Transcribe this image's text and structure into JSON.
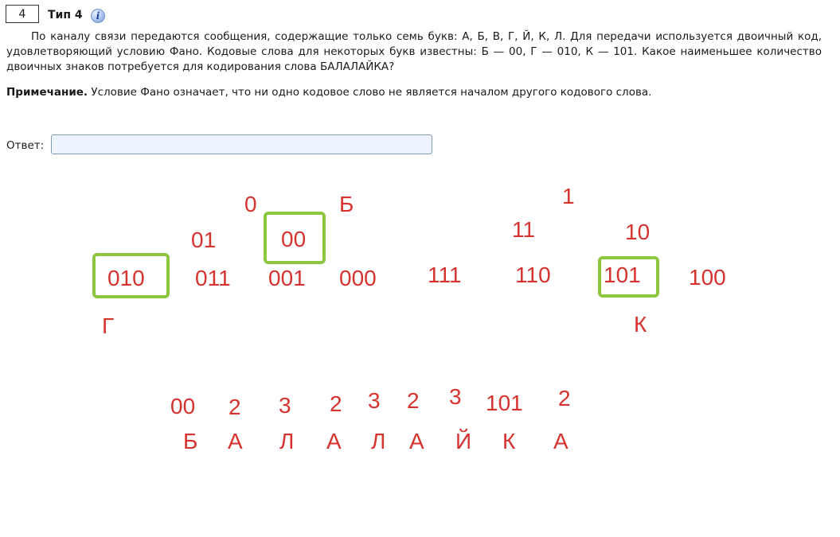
{
  "header": {
    "number": "4",
    "type_title": "Тип 4",
    "info_glyph": "i"
  },
  "problem_text": "По каналу связи передаются сообщения, содержащие только семь букв: А, Б, В, Г, Й, К, Л. Для передачи используется двоичный код, удовлетворяющий условию Фано. Кодовые слова для некоторых букв известны: Б — 00, Г — 010, К — 101. Какое наименьшее количество двоичных знаков потребуется для кодирования слова БАЛАЛАЙКА?",
  "note": {
    "label": "Примечание.",
    "text": " Условие Фано означает, что ни одно кодовое слово не является началом другого кодового слова."
  },
  "answer": {
    "label": "Ответ:",
    "value": "",
    "placeholder": ""
  },
  "annotations": {
    "tree": {
      "n0": "0",
      "n1": "1",
      "n01": "01",
      "n00": "00",
      "n11": "11",
      "n10": "10",
      "n010": "010",
      "n011": "011",
      "n001": "001",
      "n000": "000",
      "n111": "111",
      "n110": "110",
      "n101": "101",
      "n100": "100",
      "letter_b": "Б",
      "letter_g": "Г",
      "letter_k": "К"
    },
    "word_codes": [
      "00",
      "2",
      "3",
      "2",
      "3",
      "2",
      "3",
      "101",
      "2"
    ],
    "word_letters": [
      "Б",
      "А",
      "Л",
      "А",
      "Л",
      "А",
      "Й",
      "К",
      "А"
    ]
  },
  "colors": {
    "annotation_red": "#d6332f",
    "highlight_green": "#8dc63f"
  }
}
